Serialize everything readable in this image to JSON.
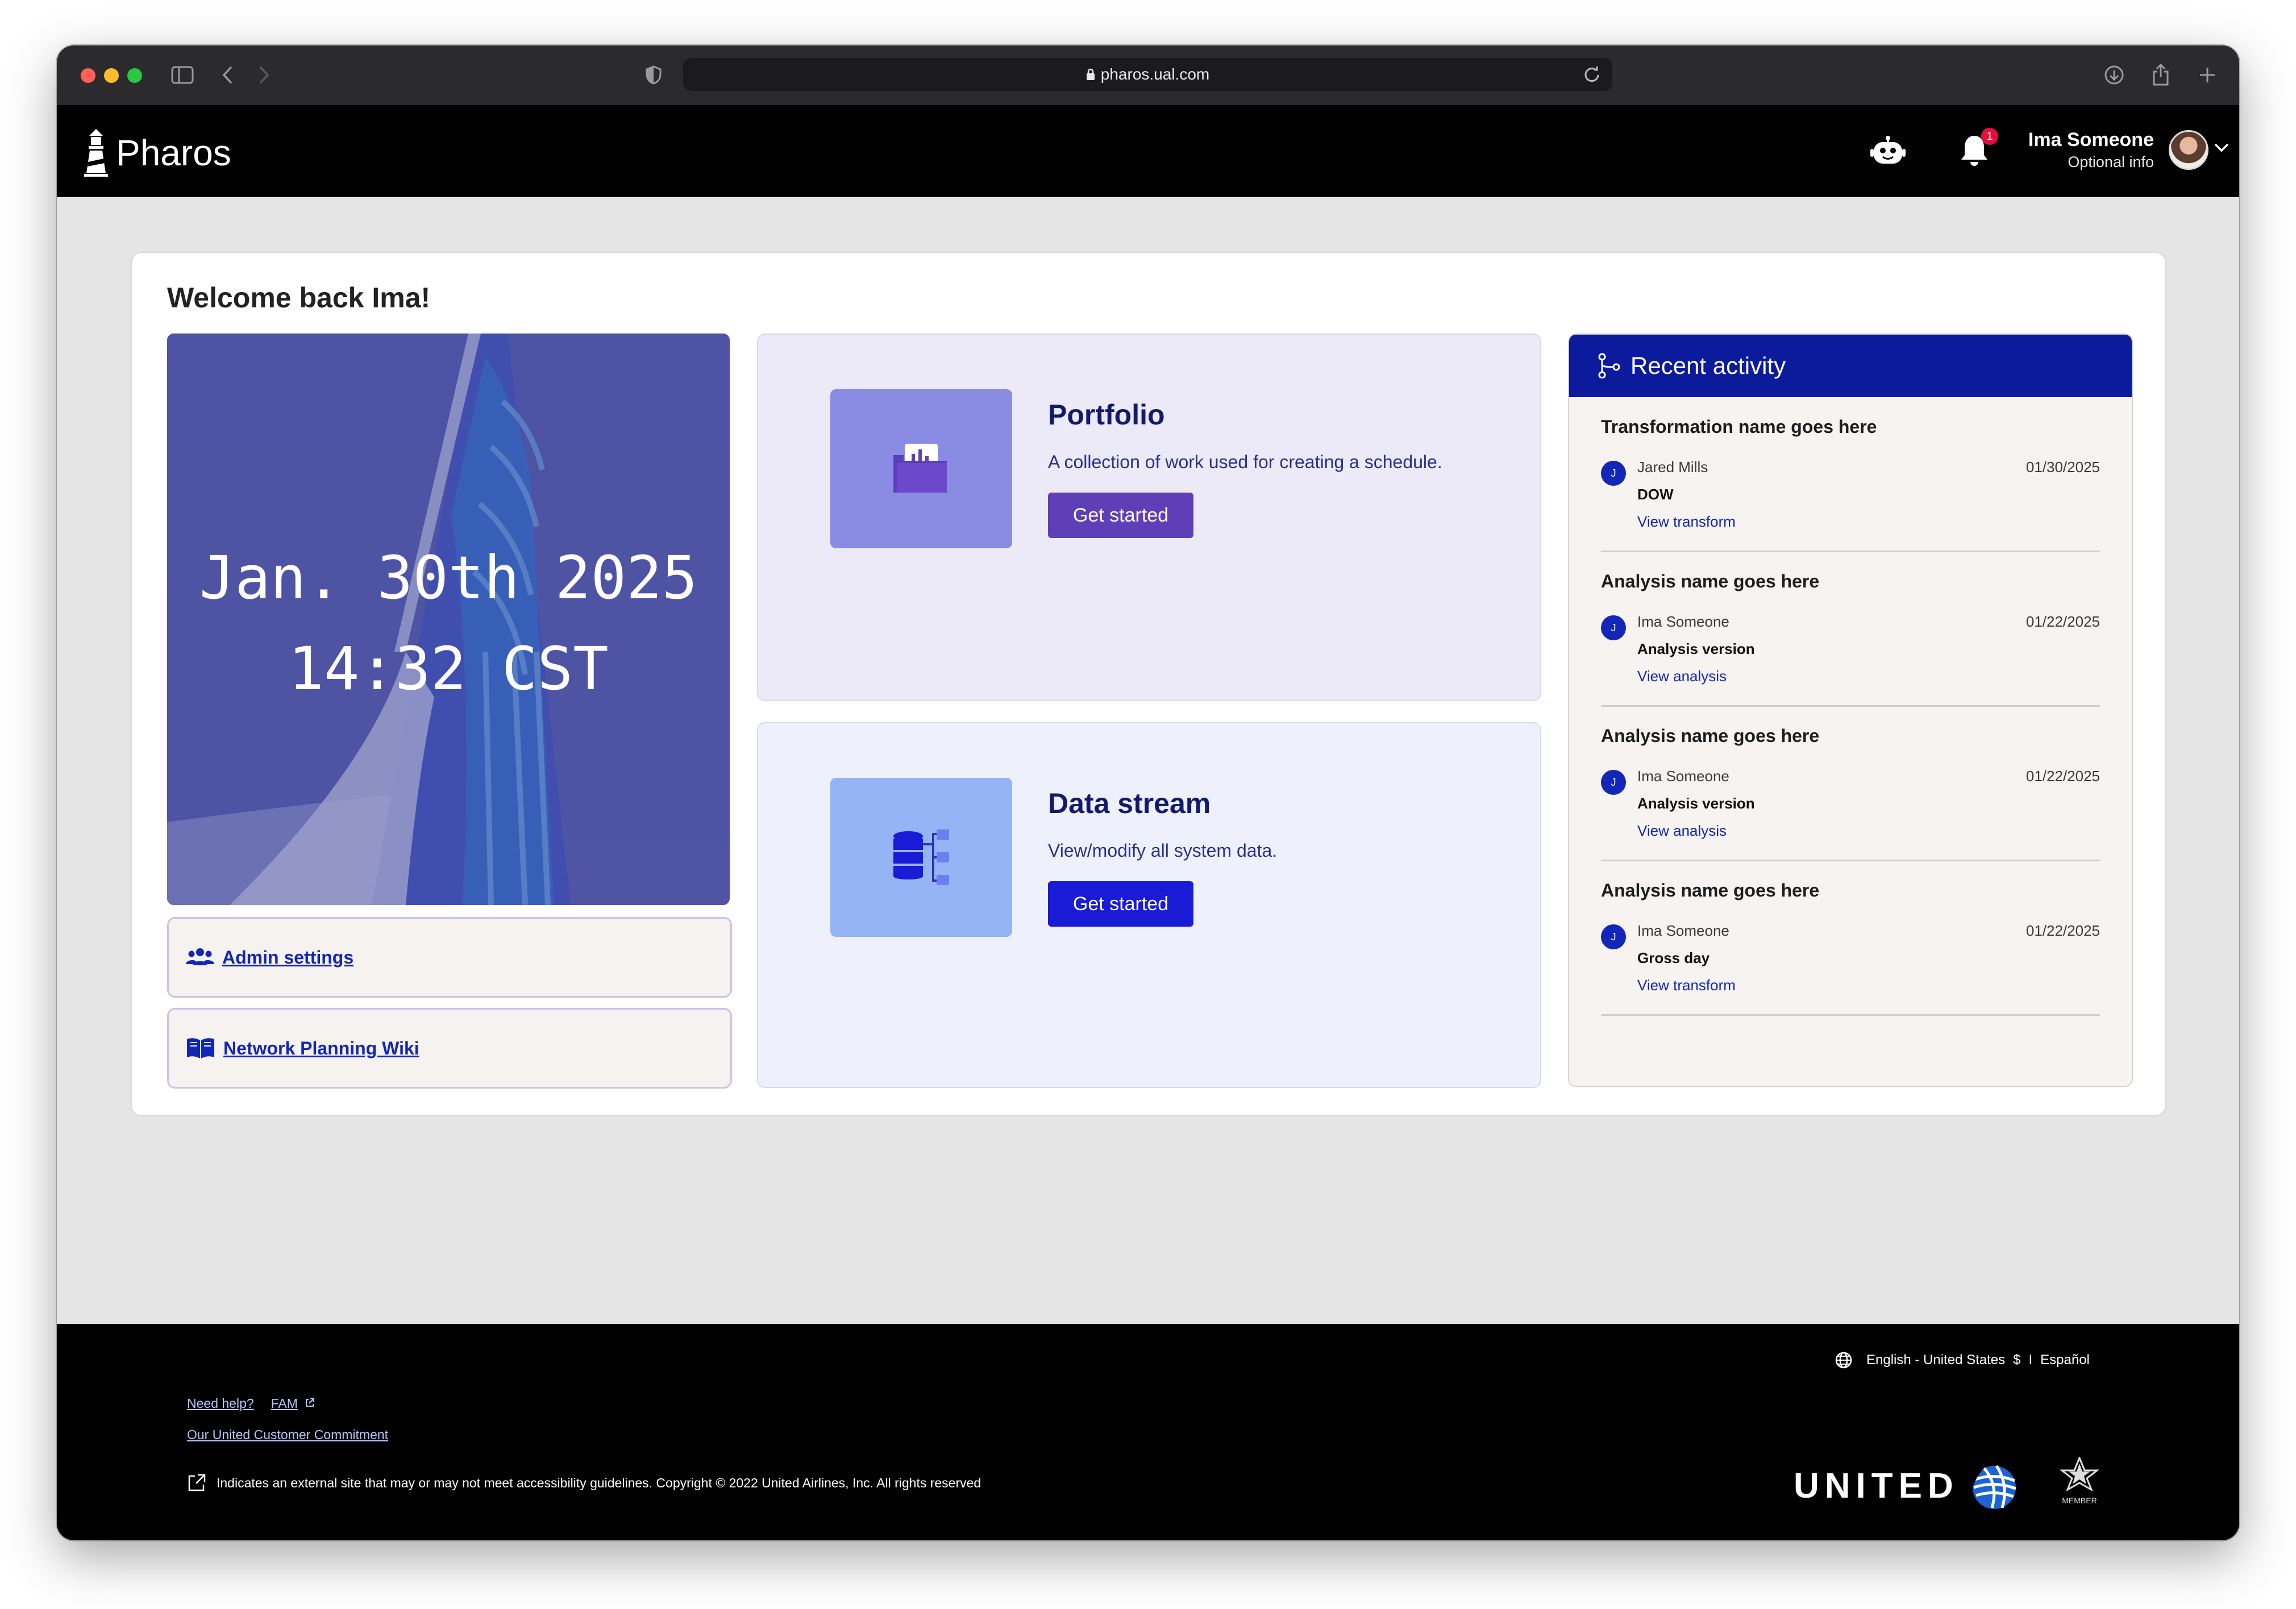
{
  "browser": {
    "url": "pharos.ual.com"
  },
  "header": {
    "app_name": "Pharos",
    "notification_count": "1",
    "user_name": "Ima Someone",
    "user_sub": "Optional info"
  },
  "main": {
    "welcome": "Welcome back Ima!",
    "hero_date": "Jan. 30th 2025",
    "hero_time": "14:32 CST",
    "links": [
      {
        "label": "Admin settings"
      },
      {
        "label": "Network Planning Wiki"
      }
    ],
    "features": [
      {
        "title": "Portfolio",
        "description": "A collection of work used for creating a schedule.",
        "button": "Get started"
      },
      {
        "title": "Data stream",
        "description": "View/modify all system data.",
        "button": "Get started"
      }
    ]
  },
  "activity": {
    "title": "Recent activity",
    "items": [
      {
        "title": "Transformation name goes here",
        "avatar": "J",
        "user": "Jared Mills",
        "date": "01/30/2025",
        "detail": "DOW",
        "link": "View transform"
      },
      {
        "title": "Analysis name goes here",
        "avatar": "J",
        "user": "Ima Someone",
        "date": "01/22/2025",
        "detail": "Analysis version",
        "link": "View analysis"
      },
      {
        "title": "Analysis name goes here",
        "avatar": "J",
        "user": "Ima Someone",
        "date": "01/22/2025",
        "detail": "Analysis version",
        "link": "View analysis"
      },
      {
        "title": "Analysis name goes here",
        "avatar": "J",
        "user": "Ima Someone",
        "date": "01/22/2025",
        "detail": "Gross day",
        "link": "View transform"
      }
    ]
  },
  "footer": {
    "language": "English - United States",
    "currency": "$",
    "separator": "I",
    "alt_language": "Español",
    "need_help": "Need help?",
    "fam": "FAM",
    "commitment": "Our United Customer Commitment",
    "copyright": "Indicates an external site that may or may not meet accessibility guidelines. Copyright © 2022 United Airlines, Inc. All rights reserved",
    "brand": "UNITED",
    "alliance": "MEMBER"
  },
  "colors": {
    "header_bg": "#000000",
    "activity_head": "#0c1a9c",
    "portfolio_button": "#5e3fb8",
    "datastream_button": "#1a1bd6",
    "link": "#1226b8"
  }
}
